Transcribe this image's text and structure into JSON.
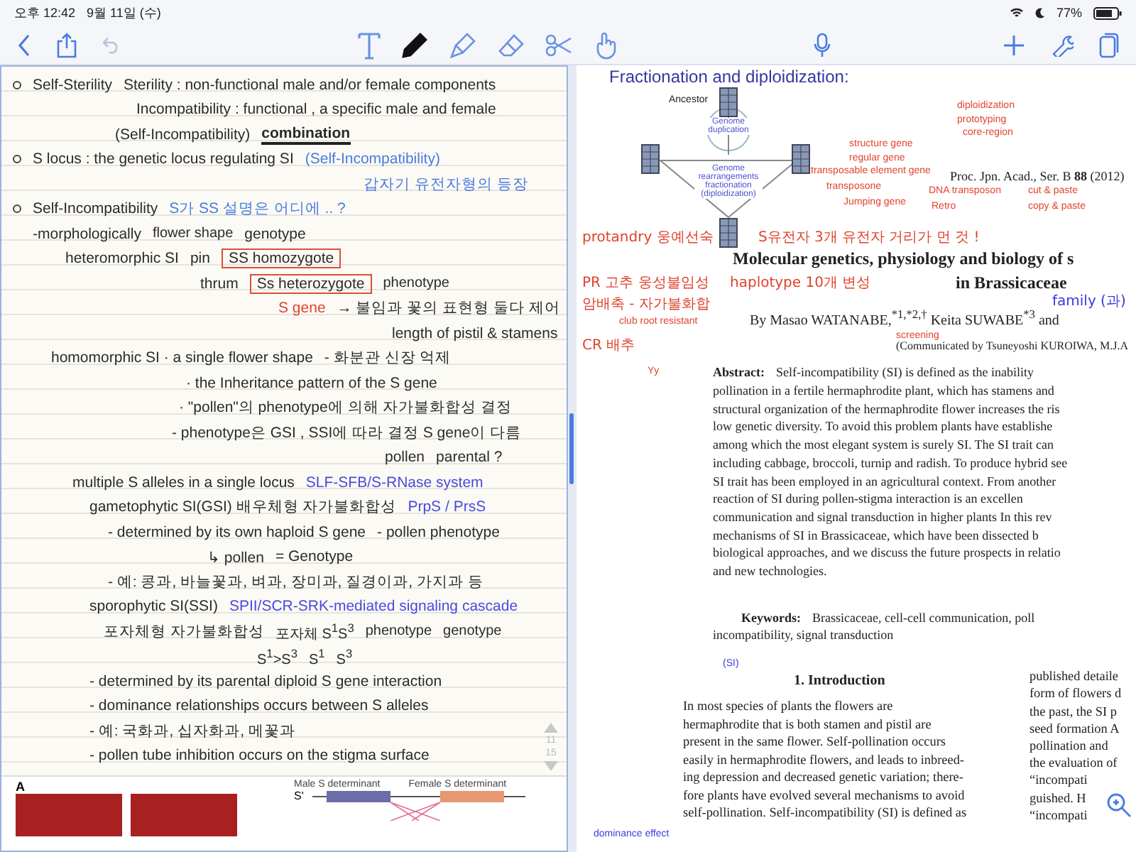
{
  "status_bar": {
    "time": "오후 12:42",
    "date": "9월 11일 (수)",
    "battery": "77%"
  },
  "toolbar": {
    "undo_disabled": true,
    "tools": [
      {
        "kind": "text",
        "selected": false
      },
      {
        "kind": "pen",
        "selected": true
      },
      {
        "kind": "highlighter",
        "selected": false
      },
      {
        "kind": "eraser",
        "selected": false
      },
      {
        "kind": "lasso",
        "selected": false
      },
      {
        "kind": "hand",
        "selected": false
      }
    ]
  },
  "notes": [
    {
      "bullet": true,
      "segments": [
        {
          "text": "Self-Sterility"
        },
        {
          "text": "Sterility : non-functional male and/or female components"
        }
      ]
    },
    {
      "bullet": false,
      "segments": [
        {
          "text": "Incompatibility : functional , a specific male and female"
        }
      ]
    },
    {
      "bullet": false,
      "segments": [
        {
          "text": "(Self-Incompatibility)"
        },
        {
          "text": "combination",
          "kind": "underline"
        }
      ]
    },
    {
      "bullet": true,
      "segments": [
        {
          "text": "S locus : the genetic locus regulating SI"
        },
        {
          "text": "(Self-Incompatibility)",
          "color": "#4a7be0"
        }
      ]
    },
    {
      "bullet": false,
      "segments": [
        {
          "text": "갑자기 유전자형의 등장",
          "color": "#4a7be0"
        }
      ]
    },
    {
      "bullet": true,
      "segments": [
        {
          "text": "Self-Incompatibility"
        },
        {
          "text": "S가 SS 설명은 어디에 .. ?",
          "color": "#4a7be0"
        }
      ]
    },
    {
      "bullet": false,
      "segments": [
        {
          "text": "-morphologically"
        },
        {
          "text": "flower shape",
          "kind": "small"
        },
        {
          "text": "genotype"
        }
      ]
    },
    {
      "bullet": false,
      "segments": [
        {
          "text": "heteromorphic SI"
        },
        {
          "text": "pin"
        },
        {
          "text": "SS homozygote",
          "kind": "box"
        }
      ]
    },
    {
      "bullet": false,
      "segments": [
        {
          "text": "thrum"
        },
        {
          "text": "Ss heterozygote",
          "kind": "box"
        },
        {
          "text": "phenotype",
          "kind": "small"
        }
      ]
    },
    {
      "bullet": false,
      "segments": [
        {
          "text": "S gene",
          "color": "#e0442c"
        },
        {
          "text": "→ 불임과 꽃의 표현형 둘다 제어"
        }
      ]
    },
    {
      "bullet": false,
      "segments": [
        {
          "text": "length of pistil & stamens"
        }
      ]
    },
    {
      "bullet": false,
      "segments": [
        {
          "text": "homomorphic SI · a single flower shape"
        },
        {
          "text": "- 화분관 신장 억제"
        }
      ]
    },
    {
      "bullet": false,
      "segments": [
        {
          "text": "· the Inheritance pattern of the S gene"
        }
      ]
    },
    {
      "bullet": false,
      "segments": [
        {
          "text": "· \"pollen\"의 phenotype에 의해 자가불화합성 결정"
        }
      ]
    },
    {
      "bullet": false,
      "segments": [
        {
          "text": "- phenotype은 GSI , SSI에 따라 결정 S gene이 다름"
        }
      ]
    },
    {
      "bullet": false,
      "segments": [
        {
          "text": "pollen"
        },
        {
          "text": "parental ?"
        }
      ]
    },
    {
      "bullet": false,
      "segments": [
        {
          "text": "multiple S alleles in a single locus"
        },
        {
          "text": "SLF-SFB/S-RNase system",
          "color": "#4a4ae0"
        }
      ]
    },
    {
      "bullet": false,
      "segments": [
        {
          "text": "gametophytic SI(GSI) 배우체형 자가불화합성"
        },
        {
          "text": "PrpS / PrsS",
          "color": "#4a4ae0"
        }
      ]
    },
    {
      "bullet": false,
      "segments": [
        {
          "text": "- determined by its own haploid S gene"
        },
        {
          "text": "- pollen phenotype"
        }
      ]
    },
    {
      "bullet": false,
      "segments": [
        {
          "text": "↳ pollen"
        },
        {
          "text": "= Genotype"
        }
      ]
    },
    {
      "bullet": false,
      "segments": [
        {
          "text": "- 예: 콩과, 바늘꽃과, 벼과, 장미과, 질경이과, 가지과 등"
        }
      ]
    },
    {
      "bullet": false,
      "segments": [
        {
          "text": "sporophytic SI(SSI)"
        },
        {
          "text": "SPII/SCR-SRK-mediated signaling cascade",
          "color": "#4a4ae0"
        }
      ]
    },
    {
      "bullet": false,
      "segments": [
        {
          "text": "포자체형 자가불화합성"
        },
        {
          "text": "포자체 S$^{1}$S$^{3}$",
          "kind": "small"
        },
        {
          "text": "phenotype",
          "kind": "small"
        },
        {
          "text": "genotype",
          "kind": "small"
        }
      ]
    },
    {
      "bullet": false,
      "segments": [
        {
          "text": "S$^{1}$>S$^{3}$",
          "kind": "small"
        },
        {
          "text": "S$^{1}$",
          "kind": "small"
        },
        {
          "text": "S$^{3}$",
          "kind": "small"
        }
      ]
    },
    {
      "bullet": false,
      "segments": [
        {
          "text": "- determined by its parental diploid S gene interaction"
        }
      ]
    },
    {
      "bullet": false,
      "segments": [
        {
          "text": "- dominance relationships occurs between S alleles"
        }
      ]
    },
    {
      "bullet": false,
      "segments": [
        {
          "text": "- 예: 국화과, 십자화과, 메꽃과"
        }
      ]
    },
    {
      "bullet": false,
      "segments": [
        {
          "text": "- pollen tube inhibition occurs on the stigma surface"
        }
      ]
    }
  ],
  "page_indicator": {
    "current": "11",
    "total": "15"
  },
  "figure": {
    "panel_label": "A",
    "male": "Male S determinant",
    "female": "Female S determinant",
    "row_label": "S'"
  },
  "paper": {
    "slide_title": "Fractionation and diploidization:",
    "ancestor": "Ancestor",
    "duplication": "Genome duplication",
    "rearrangement": "Genome rearrangements fractionation (diploidization)",
    "citation": "Proc. Jpn. Acad., Ser. B **88** (2012)",
    "title_lines": [
      "Molecular genetics, physiology and biology of s",
      "in Brassicaceae"
    ],
    "authors": "By Masao WATANABE,$^{*1,*2,†}$ Keita SUWABE$^{*3}$ and",
    "communicated": "(Communicated by Tsuneyoshi KUROIWA, M.J.A",
    "abstract_label": "Abstract:",
    "abstract_lines": [
      "Self-incompatibility (SI) is defined as the inability",
      "pollination in a fertile hermaphrodite plant, which has stamens and",
      "structural organization of the hermaphrodite flower increases the ris",
      "low genetic diversity. To avoid this problem plants have establishe",
      "among which the most elegant system is surely SI. The SI trait can",
      "including cabbage, broccoli, turnip and radish. To produce hybrid see",
      "SI trait has been employed in an agricultural context. From another",
      "reaction of SI during pollen-stigma interaction is an excellen",
      "communication and signal transduction in higher plants In this rev",
      "mechanisms of SI in Brassicaceae, which have been dissected b",
      "biological approaches, and we discuss the future prospects in relatio",
      "and new technologies."
    ],
    "keywords_label": "Keywords:",
    "keywords_lines": [
      "Brassicaceae, cell-cell communication, poll",
      "incompatibility, signal transduction"
    ],
    "section": "1. Introduction",
    "intro_lines": [
      "In most species of plants the flowers are",
      "hermaphrodite that is both stamen and pistil are",
      "present in the same flower. Self-pollination occurs",
      "easily in hermaphrodite flowers, and leads to inbreed-",
      "ing depression and decreased genetic variation; there-",
      "fore plants have evolved several mechanisms to avoid",
      "self-pollination. Self-incompatibility (SI) is defined as"
    ],
    "column_2_lines": [
      "published detaile",
      "form of flowers d",
      "the past, the SI p",
      "seed formation A",
      "pollination and",
      "the evaluation of",
      "“incompati",
      "guished. H",
      "“incompati"
    ]
  },
  "annotations": [
    {
      "text": "protandry 웅예선숙",
      "color": "#e0442c"
    },
    {
      "text": "structure gene",
      "color": "#e0442c"
    },
    {
      "text": "regular gene",
      "color": "#e0442c"
    },
    {
      "text": "transposable element gene",
      "color": "#e0442c"
    },
    {
      "text": "transposone",
      "color": "#e0442c"
    },
    {
      "text": "Jumping gene",
      "color": "#e0442c"
    },
    {
      "text": "DNA transposon",
      "color": "#e0442c"
    },
    {
      "text": "Retro",
      "color": "#e0442c"
    },
    {
      "text": "cut & paste",
      "color": "#e0442c"
    },
    {
      "text": "copy & paste",
      "color": "#e0442c"
    },
    {
      "text": "diploidization",
      "color": "#e0442c"
    },
    {
      "text": "prototyping",
      "color": "#e0442c"
    },
    {
      "text": "core-region",
      "color": "#e0442c"
    },
    {
      "text": "S유전자 3개 유전자 거리가 먼 것 !",
      "color": "#e0442c"
    },
    {
      "text": "PR 고추 웅성불임성",
      "color": "#e0442c"
    },
    {
      "text": "암배축 - 자가불화합",
      "color": "#e0442c"
    },
    {
      "text": "haplotype 10개 변성",
      "color": "#e0442c"
    },
    {
      "text": "club root resistant",
      "color": "#e0442c"
    },
    {
      "text": "CR 배추",
      "color": "#e0442c"
    },
    {
      "text": "screening",
      "color": "#e0442c"
    },
    {
      "text": "family (과)",
      "color": "#3a3ae0"
    },
    {
      "text": "Yy",
      "color": "#e0442c"
    },
    {
      "text": "(SI)",
      "color": "#3a3ae0"
    },
    {
      "text": "dominance effect",
      "color": "#3a3ae0"
    }
  ]
}
